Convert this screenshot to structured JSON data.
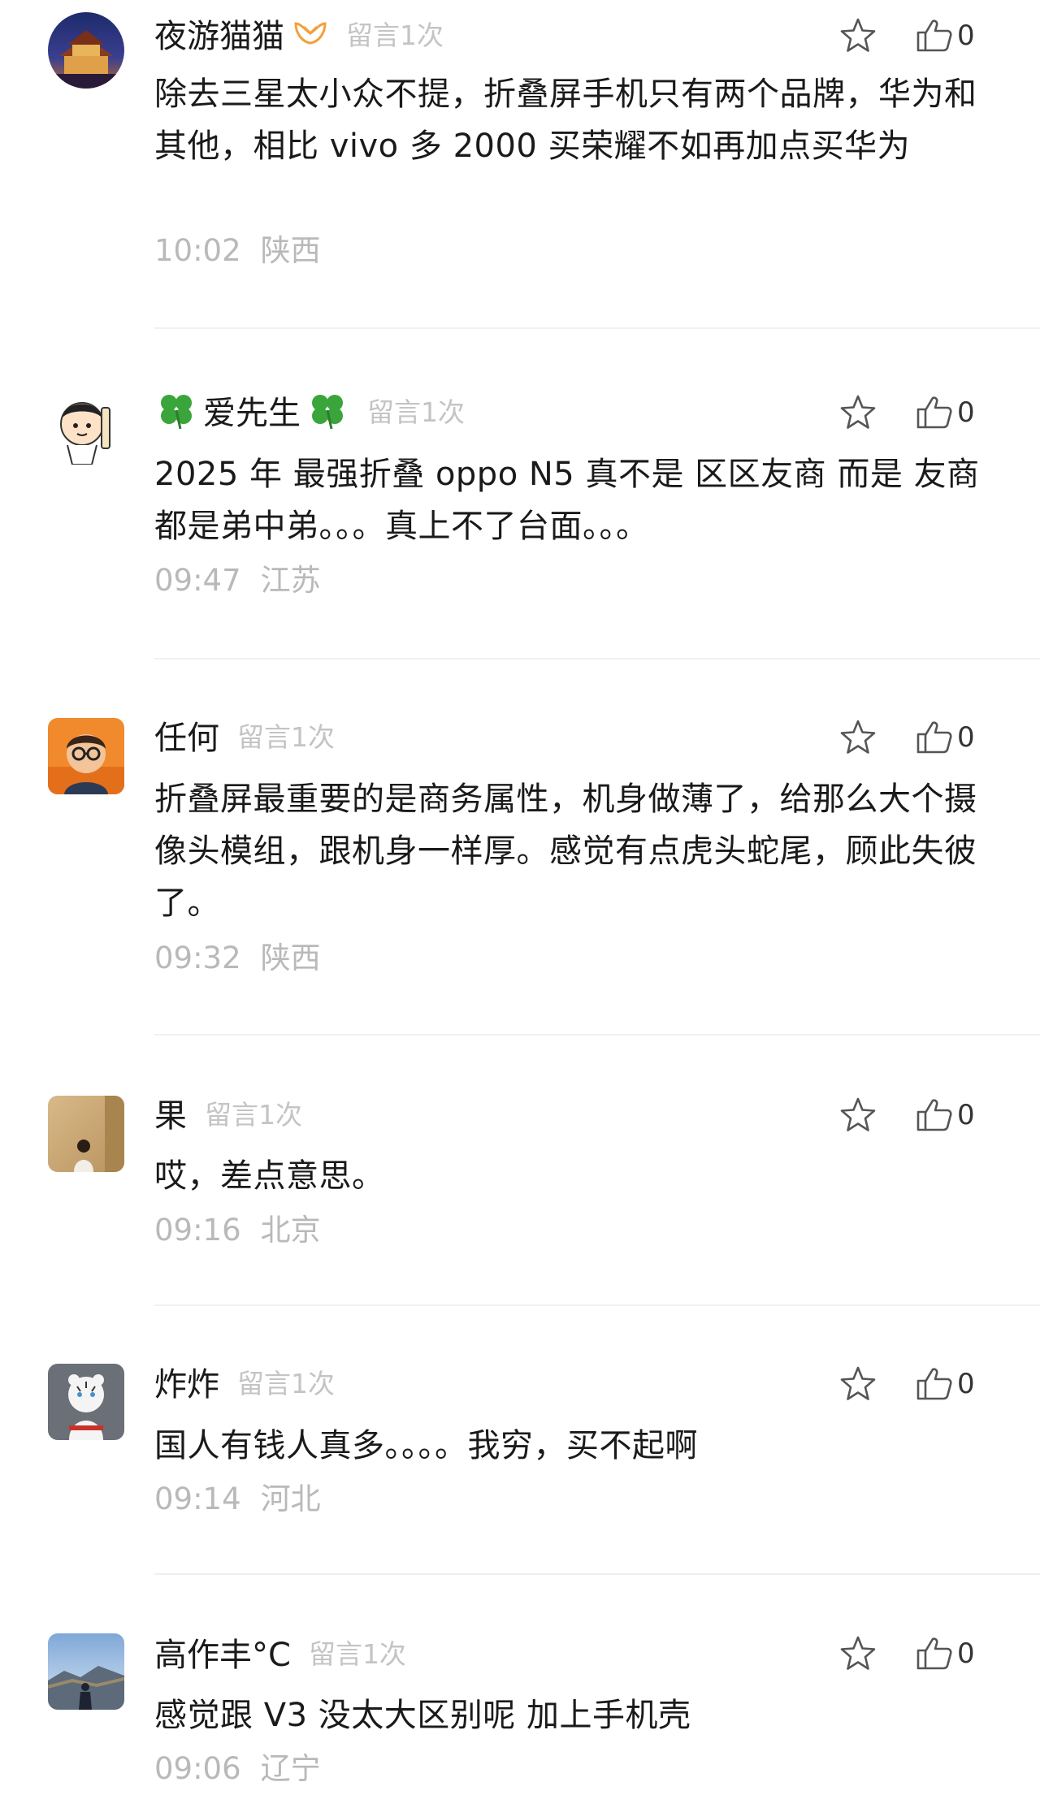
{
  "comments": [
    {
      "name": "夜游猫猫",
      "tag": "留言1次",
      "text": "除去三星太小众不提，折叠屏手机只有两个品牌，华为和其他，相比 vivo 多 2000 买荣耀不如再加点买华为",
      "time": "10:02",
      "location": "陕西",
      "likes": "0"
    },
    {
      "name": "爱先生",
      "tag": "留言1次",
      "text": "2025 年 最强折叠 oppo N5 真不是 区区友商 而是 友商都是弟中弟。。。真上不了台面。。。",
      "time": "09:47",
      "location": "江苏",
      "likes": "0"
    },
    {
      "name": "任何",
      "tag": "留言1次",
      "text": "折叠屏最重要的是商务属性，机身做薄了，给那么大个摄像头模组，跟机身一样厚。感觉有点虎头蛇尾，顾此失彼了。",
      "time": "09:32",
      "location": "陕西",
      "likes": "0"
    },
    {
      "name": "果",
      "tag": "留言1次",
      "text": "哎，差点意思。",
      "time": "09:16",
      "location": "北京",
      "likes": "0"
    },
    {
      "name": "炸炸",
      "tag": "留言1次",
      "text": "国人有钱人真多。。。。我穷，买不起啊",
      "time": "09:14",
      "location": "河北",
      "likes": "0"
    },
    {
      "name": "高作丰°C",
      "tag": "留言1次",
      "text": "感觉跟 V3 没太大区别呢  加上手机壳",
      "time": "09:06",
      "location": "辽宁",
      "likes": "0"
    }
  ],
  "icons": {
    "favorite": "star-outline-icon",
    "like": "thumbs-up-outline-icon",
    "badge": "orange-ribbon-badge-icon",
    "clover": "four-leaf-clover-icon"
  },
  "colors": {
    "name": "#1a1a1a",
    "meta": "#b9b9b9",
    "badge": "#f3a03c",
    "clover": "#3aa53a"
  }
}
